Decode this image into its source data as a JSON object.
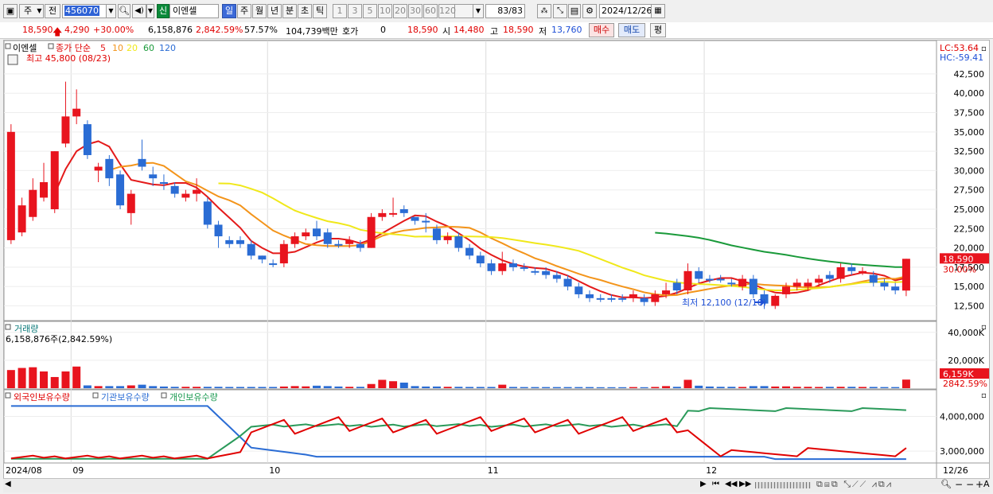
{
  "toolbar": {
    "period_label": "주",
    "prev_label": "전",
    "code": "456070",
    "new_badge": "신",
    "stock_name": "이엔셀",
    "tabs": [
      "일",
      "주",
      "월",
      "년",
      "분",
      "초",
      "틱"
    ],
    "active_tab": "일",
    "intervals": [
      "1",
      "3",
      "5",
      "10",
      "20",
      "30",
      "60",
      "120"
    ],
    "count": "83",
    "count_total": "/83",
    "date": "2024/12/26"
  },
  "quote": {
    "price": "18,590",
    "change": "4,290",
    "change_pct": "+30.00%",
    "volume": "6,158,876",
    "volume_ratio": "2,842.59%",
    "turnover": "57.57%",
    "amount": "104,739백만",
    "hoga_label": "호가",
    "hoga_value": "0",
    "hoga_price": "18,590",
    "open_label": "시",
    "open": "14,480",
    "high_label": "고",
    "high": "18,590",
    "low_label": "저",
    "low": "13,760",
    "buy_label": "매수",
    "sell_label": "매도",
    "eval_label": "평"
  },
  "colors": {
    "up": "#e8141e",
    "down": "#2a6cd4",
    "ma5": "#e41a1a",
    "ma10": "#f3941a",
    "ma20": "#f0e81a",
    "ma60": "#1a9a3a",
    "ma120": "#2a6cd4"
  },
  "legend": {
    "name": "이엔셀",
    "series": "종가 단순",
    "ma": [
      "5",
      "10",
      "20",
      "60",
      "120"
    ],
    "max_label": "최고 45,800 (08/23)",
    "min_label": "최저 12,100 (12/10)",
    "lc": "LC:53.64",
    "hc": "HC:-59.41",
    "price_tag": "18,590",
    "price_pct": "30.00%"
  },
  "volume_panel": {
    "title": "거래량",
    "current": "6,158,876주(2,842.59%)",
    "tag": "6,159K",
    "tag_pct": "2842.59%"
  },
  "holder_panel": {
    "labels": [
      "외국인보유수량",
      "기관보유수량",
      "개인보유수량"
    ]
  },
  "price_axis": [
    "42,500",
    "40,000",
    "37,500",
    "35,000",
    "32,500",
    "30,000",
    "27,500",
    "25,000",
    "22,500",
    "20,000",
    "17,500",
    "15,000",
    "12,500"
  ],
  "volume_axis": [
    "40,000K",
    "20,000K"
  ],
  "holder_axis": [
    "4,000,000",
    "3,000,000"
  ],
  "date_axis": [
    "2024/08",
    "09",
    "10",
    "11",
    "12",
    "12/26"
  ],
  "chart_data": {
    "type": "candlestick",
    "start": "2024/08/12",
    "candles": [
      [
        35000,
        21000,
        36000,
        20500,
        "up"
      ],
      [
        22000,
        25500,
        26500,
        21500,
        "up"
      ],
      [
        24000,
        27500,
        29000,
        23500,
        "up"
      ],
      [
        26500,
        28500,
        31000,
        26000,
        "up"
      ],
      [
        25000,
        32500,
        32500,
        24500,
        "up"
      ],
      [
        33500,
        37000,
        41500,
        33000,
        "up"
      ],
      [
        38000,
        37000,
        40500,
        36000,
        "up"
      ],
      [
        36000,
        32000,
        36500,
        31500,
        "down"
      ],
      [
        30000,
        30500,
        31000,
        28500,
        "up"
      ],
      [
        31500,
        29000,
        32000,
        28000,
        "down"
      ],
      [
        29500,
        25500,
        30000,
        25000,
        "down"
      ],
      [
        24500,
        27000,
        27500,
        23000,
        "up"
      ],
      [
        31500,
        30500,
        34000,
        30000,
        "down"
      ],
      [
        29500,
        29000,
        30500,
        28000,
        "down"
      ],
      [
        28500,
        28500,
        29500,
        27500,
        "down"
      ],
      [
        28000,
        27000,
        28500,
        26500,
        "down"
      ],
      [
        26500,
        27000,
        27500,
        26000,
        "up"
      ],
      [
        27000,
        27500,
        29000,
        26000,
        "up"
      ],
      [
        26000,
        23000,
        26500,
        22500,
        "down"
      ],
      [
        23000,
        21500,
        23500,
        20000,
        "down"
      ],
      [
        21000,
        20500,
        21500,
        20000,
        "down"
      ],
      [
        21000,
        20500,
        21500,
        20000,
        "down"
      ],
      [
        20500,
        19000,
        21000,
        18500,
        "down"
      ],
      [
        19000,
        18500,
        19000,
        18000,
        "down"
      ],
      [
        18000,
        18000,
        18500,
        17500,
        "down"
      ],
      [
        18000,
        20500,
        21000,
        17500,
        "up"
      ],
      [
        20500,
        21500,
        22000,
        20000,
        "up"
      ],
      [
        21500,
        22000,
        22500,
        21000,
        "up"
      ],
      [
        22500,
        21500,
        23500,
        21000,
        "down"
      ],
      [
        22000,
        20500,
        22500,
        20000,
        "down"
      ],
      [
        20500,
        20500,
        21000,
        20000,
        "down"
      ],
      [
        21000,
        20500,
        21500,
        20000,
        "up"
      ],
      [
        20500,
        20000,
        21000,
        19500,
        "down"
      ],
      [
        20000,
        24000,
        24500,
        20000,
        "up"
      ],
      [
        24000,
        24500,
        25000,
        23500,
        "up"
      ],
      [
        24500,
        24500,
        26500,
        24000,
        "up"
      ],
      [
        25000,
        24500,
        25500,
        24000,
        "down"
      ],
      [
        24000,
        23500,
        24000,
        23000,
        "down"
      ],
      [
        23500,
        23500,
        24500,
        22000,
        "down"
      ],
      [
        22500,
        21000,
        23000,
        20500,
        "down"
      ],
      [
        21000,
        21500,
        22000,
        20500,
        "up"
      ],
      [
        21500,
        20000,
        22000,
        19500,
        "down"
      ],
      [
        20000,
        19000,
        20500,
        18500,
        "down"
      ],
      [
        19000,
        18000,
        19500,
        17500,
        "down"
      ],
      [
        18000,
        17000,
        18500,
        16500,
        "down"
      ],
      [
        17000,
        18000,
        19500,
        16500,
        "up"
      ],
      [
        18000,
        17500,
        18500,
        17000,
        "down"
      ],
      [
        17500,
        17500,
        18000,
        17000,
        "down"
      ],
      [
        17000,
        17000,
        17500,
        16500,
        "down"
      ],
      [
        17000,
        16500,
        17500,
        16000,
        "down"
      ],
      [
        16500,
        16000,
        17000,
        15500,
        "down"
      ],
      [
        16000,
        15000,
        16500,
        14500,
        "down"
      ],
      [
        15000,
        14000,
        15500,
        13500,
        "down"
      ],
      [
        14000,
        13500,
        14500,
        13000,
        "down"
      ],
      [
        13500,
        13500,
        14000,
        13000,
        "down"
      ],
      [
        13500,
        13500,
        14000,
        13000,
        "down"
      ],
      [
        13500,
        13500,
        14000,
        13000,
        "down"
      ],
      [
        13500,
        14000,
        14500,
        13000,
        "up"
      ],
      [
        13500,
        13000,
        14000,
        12500,
        "down"
      ],
      [
        13000,
        14000,
        14500,
        12500,
        "up"
      ],
      [
        14000,
        14500,
        15500,
        13500,
        "up"
      ],
      [
        14500,
        15500,
        16000,
        14000,
        "down"
      ],
      [
        14500,
        17000,
        18000,
        14000,
        "up"
      ],
      [
        17000,
        16000,
        17500,
        15500,
        "down"
      ],
      [
        16000,
        16000,
        16500,
        15500,
        "down"
      ],
      [
        16000,
        16000,
        16500,
        15500,
        "down"
      ],
      [
        15500,
        15500,
        16000,
        15000,
        "down"
      ],
      [
        16000,
        15000,
        16500,
        14500,
        "up"
      ],
      [
        16000,
        14000,
        16500,
        13500,
        "down"
      ],
      [
        14000,
        12800,
        14500,
        12100,
        "down"
      ],
      [
        12500,
        13800,
        14000,
        12100,
        "up"
      ],
      [
        14000,
        15000,
        15500,
        13500,
        "up"
      ],
      [
        15000,
        15500,
        16000,
        14500,
        "up"
      ],
      [
        15000,
        15500,
        16000,
        14500,
        "up"
      ],
      [
        15500,
        16000,
        16500,
        15000,
        "up"
      ],
      [
        16000,
        16500,
        17000,
        15500,
        "down"
      ],
      [
        16000,
        17500,
        18000,
        15500,
        "up"
      ],
      [
        17500,
        17000,
        18000,
        16500,
        "down"
      ],
      [
        17000,
        17000,
        17500,
        16500,
        "up"
      ],
      [
        16500,
        15500,
        17000,
        15000,
        "down"
      ],
      [
        15500,
        15000,
        16000,
        14500,
        "down"
      ],
      [
        15000,
        14500,
        15500,
        14000,
        "down"
      ],
      [
        14480,
        18590,
        18590,
        13760,
        "up"
      ]
    ],
    "volume_k": [
      13000,
      14500,
      15000,
      12000,
      8000,
      12000,
      15500,
      2000,
      1500,
      1500,
      1500,
      2000,
      2500,
      1500,
      1200,
      1000,
      1000,
      1000,
      1000,
      1000,
      900,
      900,
      900,
      900,
      900,
      1200,
      1500,
      1300,
      1800,
      1500,
      1200,
      1000,
      1000,
      3000,
      6000,
      5000,
      4000,
      1500,
      1200,
      1200,
      1000,
      1000,
      900,
      900,
      900,
      2500,
      900,
      800,
      800,
      800,
      800,
      800,
      800,
      800,
      700,
      700,
      700,
      800,
      700,
      900,
      1500,
      1000,
      6000,
      1800,
      1200,
      1000,
      1000,
      900,
      1500,
      1500,
      1200,
      1300,
      1000,
      1000,
      900,
      1000,
      1000,
      1000,
      900,
      900,
      800,
      800,
      6159
    ],
    "holders": {
      "foreign": "red",
      "institution": "blue",
      "individual": "green"
    }
  }
}
